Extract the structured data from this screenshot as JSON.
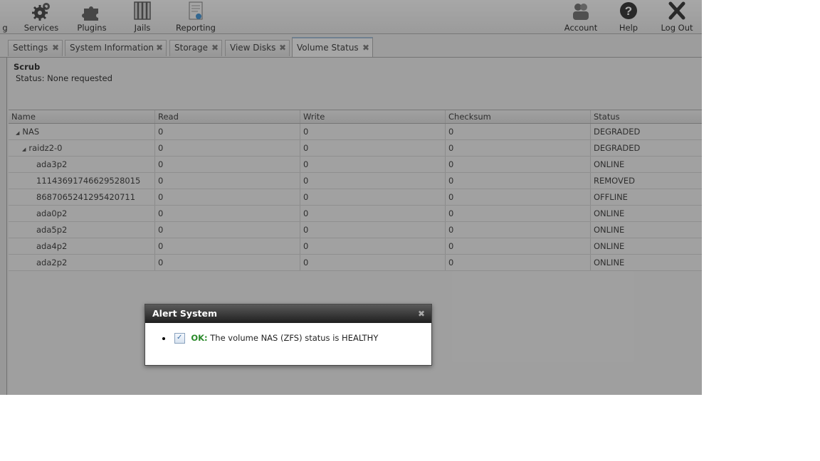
{
  "toolbar": {
    "left_items": [
      {
        "label": "g",
        "icon": "partial-icon"
      },
      {
        "label": "Services",
        "icon": "gears-icon"
      },
      {
        "label": "Plugins",
        "icon": "puzzle-icon"
      },
      {
        "label": "Jails",
        "icon": "jail-bars-icon"
      },
      {
        "label": "Reporting",
        "icon": "report-icon"
      }
    ],
    "right_items": [
      {
        "label": "Account",
        "icon": "users-icon"
      },
      {
        "label": "Help",
        "icon": "help-icon"
      },
      {
        "label": "Log Out",
        "icon": "logout-x-icon"
      }
    ]
  },
  "tabs": [
    {
      "label": "Settings",
      "close": "✖"
    },
    {
      "label": "System Information",
      "close": "✖"
    },
    {
      "label": "Storage",
      "close": "✖"
    },
    {
      "label": "View Disks",
      "close": "✖"
    },
    {
      "label": "Volume Status",
      "close": "✖",
      "active": true
    }
  ],
  "scrub": {
    "title": "Scrub",
    "status": "Status: None requested"
  },
  "grid": {
    "columns": [
      "Name",
      "Read",
      "Write",
      "Checksum",
      "Status"
    ],
    "rows": [
      {
        "name": "NAS",
        "read": "0",
        "write": "0",
        "checksum": "0",
        "status": "DEGRADED",
        "expander": "◢"
      },
      {
        "name": "raidz2-0",
        "read": "0",
        "write": "0",
        "checksum": "0",
        "status": "DEGRADED",
        "expander": "◢"
      },
      {
        "name": "ada3p2",
        "read": "0",
        "write": "0",
        "checksum": "0",
        "status": "ONLINE"
      },
      {
        "name": "11143691746629528015",
        "read": "0",
        "write": "0",
        "checksum": "0",
        "status": "REMOVED"
      },
      {
        "name": "8687065241295420711",
        "read": "0",
        "write": "0",
        "checksum": "0",
        "status": "OFFLINE"
      },
      {
        "name": "ada0p2",
        "read": "0",
        "write": "0",
        "checksum": "0",
        "status": "ONLINE"
      },
      {
        "name": "ada5p2",
        "read": "0",
        "write": "0",
        "checksum": "0",
        "status": "ONLINE"
      },
      {
        "name": "ada4p2",
        "read": "0",
        "write": "0",
        "checksum": "0",
        "status": "ONLINE"
      },
      {
        "name": "ada2p2",
        "read": "0",
        "write": "0",
        "checksum": "0",
        "status": "ONLINE"
      }
    ]
  },
  "alert_dialog": {
    "title": "Alert System",
    "close_glyph": "✖",
    "check_glyph": "✓",
    "items": [
      {
        "level": "OK:",
        "message": " The volume NAS (ZFS) status is HEALTHY"
      }
    ]
  },
  "colors": {
    "ok": "#2a8a2a",
    "dialog_title_bg": "#2b2b2b"
  }
}
